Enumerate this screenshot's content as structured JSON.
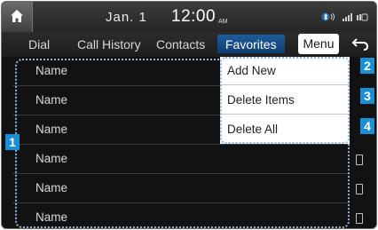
{
  "status_bar": {
    "date": "Jan. 1",
    "time": "12:00",
    "ampm": "AM",
    "icons": [
      "bluetooth-icon",
      "signal-icon",
      "battery-icon"
    ]
  },
  "tabs": [
    {
      "label": "Dial"
    },
    {
      "label": "Call History"
    },
    {
      "label": "Contacts"
    },
    {
      "label": "Favorites"
    }
  ],
  "menu_label": "Menu",
  "favorites": [
    {
      "name": "Name"
    },
    {
      "name": "Name"
    },
    {
      "name": "Name"
    },
    {
      "name": "Name"
    },
    {
      "name": "Name"
    },
    {
      "name": "Name"
    }
  ],
  "dropdown": [
    {
      "label": "Add New",
      "marker": "2"
    },
    {
      "label": "Delete Items",
      "marker": "3"
    },
    {
      "label": "Delete All",
      "marker": "4"
    }
  ],
  "list_marker": "1",
  "colors": {
    "accent": "#1b8fd6",
    "active_tab": "#1e5c9c",
    "background": "#121212"
  }
}
